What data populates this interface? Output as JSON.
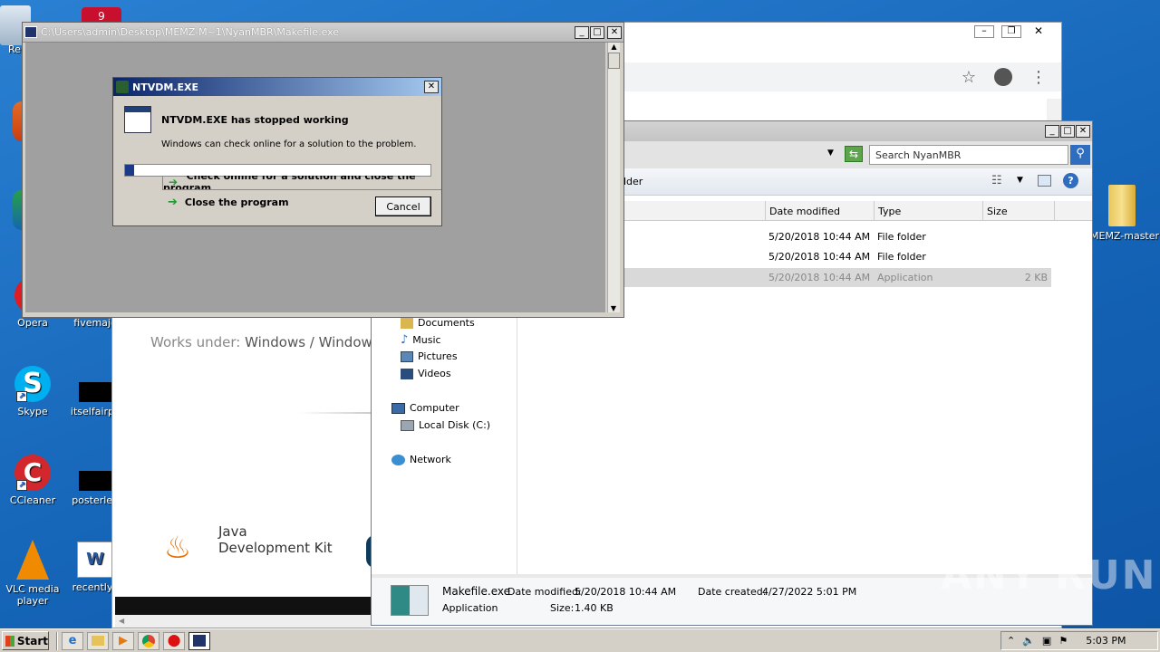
{
  "desktop": {
    "icons": [
      {
        "label": "Re",
        "icon": "recycle-bin-icon"
      },
      {
        "label": "Opera",
        "icon": "opera-icon"
      },
      {
        "label": "fivemajo",
        "icon": "file-icon"
      },
      {
        "label": "Skype",
        "icon": "skype-icon"
      },
      {
        "label": "itselfairpc",
        "icon": "file-icon"
      },
      {
        "label": "CCleaner",
        "icon": "ccleaner-icon"
      },
      {
        "label": "posterlea",
        "icon": "file-icon"
      },
      {
        "label": "VLC media player",
        "icon": "vlc-icon"
      },
      {
        "label": "recentlyc",
        "icon": "word-icon"
      },
      {
        "label": "MEMZ-master",
        "icon": "folder-icon"
      }
    ],
    "badge": "9"
  },
  "console": {
    "title": "C:\\Users\\admin\\Desktop\\MEMZ-M~1\\NyanMBR\\Makefile.exe"
  },
  "dialog": {
    "title": "NTVDM.EXE",
    "heading": "NTVDM.EXE has stopped working",
    "message": "Windows can check online for a solution to the problem.",
    "option_check": "Check online for a solution and close the program",
    "option_close": "Close the program",
    "cancel": "Cancel"
  },
  "browser": {
    "works_under_label": "Works under:",
    "works_under_value": "Windows / Windows",
    "java_line1": "Java",
    "java_line2": "Development Kit"
  },
  "explorer": {
    "search_placeholder": "Search NyanMBR",
    "toolbar_partial": "lder",
    "columns": {
      "date": "Date modified",
      "type": "Type",
      "size": "Size"
    },
    "files": [
      {
        "date": "5/20/2018 10:44 AM",
        "type": "File folder",
        "size": ""
      },
      {
        "date": "5/20/2018 10:44 AM",
        "type": "File folder",
        "size": ""
      },
      {
        "date": "5/20/2018 10:44 AM",
        "type": "Application",
        "size": "2 KB"
      }
    ],
    "nav": {
      "documents": "Documents",
      "music": "Music",
      "pictures": "Pictures",
      "videos": "Videos",
      "computer": "Computer",
      "local_disk": "Local Disk (C:)",
      "network": "Network"
    },
    "details": {
      "name": "Makefile.exe",
      "kind": "Application",
      "date_modified_label": "Date modified:",
      "date_modified": "5/20/2018 10:44 AM",
      "date_created_label": "Date created:",
      "date_created": "4/27/2022 5:01 PM",
      "size_label": "Size:",
      "size": "1.40 KB"
    }
  },
  "watermark": "ANY RUN",
  "taskbar": {
    "start": "Start",
    "clock": "5:03 PM"
  }
}
